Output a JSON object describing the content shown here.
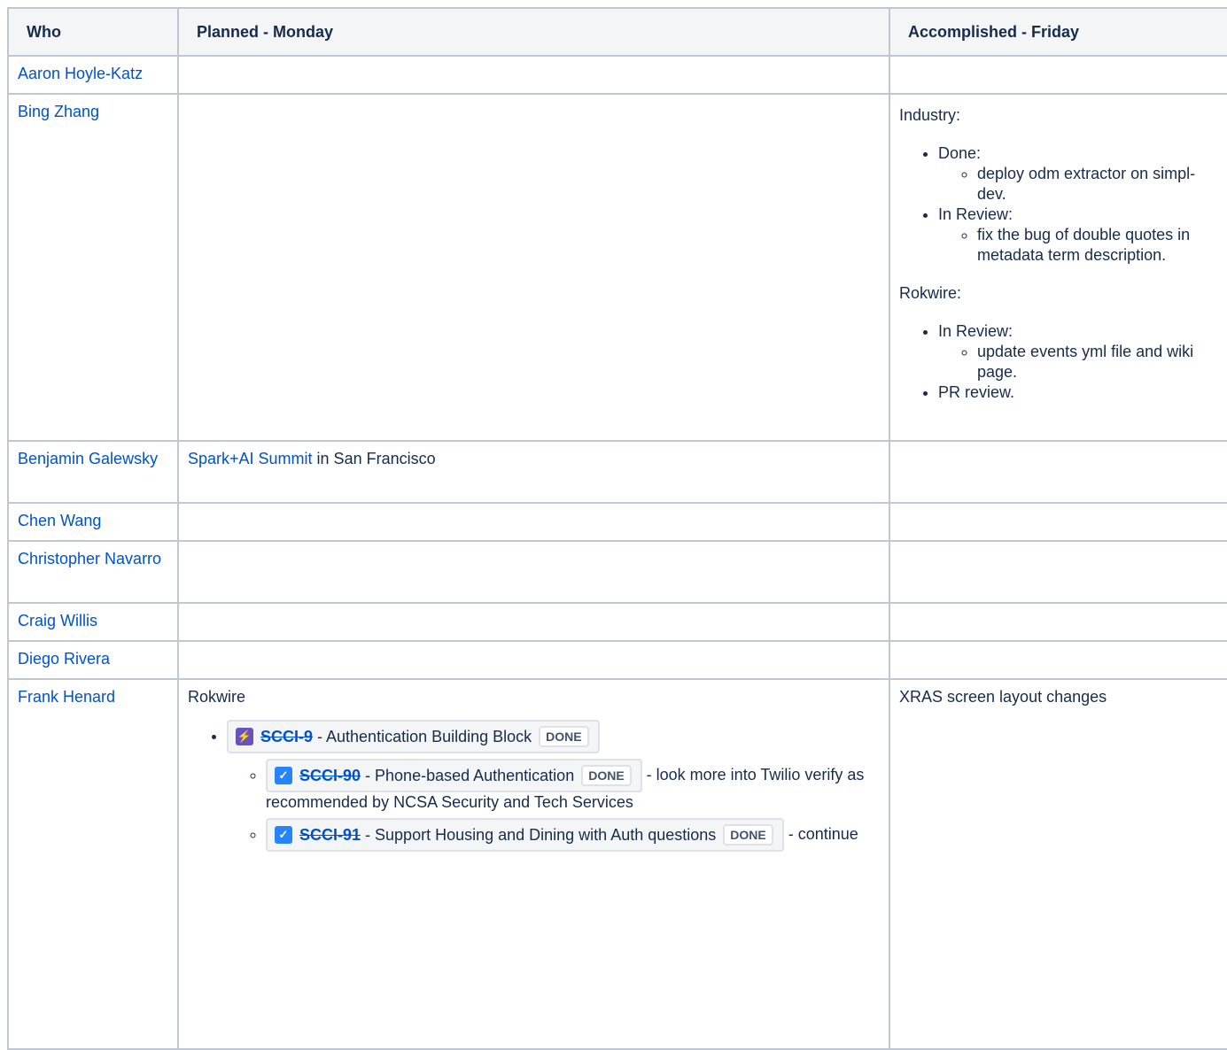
{
  "table": {
    "headers": {
      "who": "Who",
      "planned": "Planned - Monday",
      "accomplished": "Accomplished - Friday"
    }
  },
  "rows": {
    "aaron": {
      "name": "Aaron Hoyle-Katz"
    },
    "bing": {
      "name": "Bing Zhang",
      "accomplished": {
        "industry_title": "Industry:",
        "done_label": "Done:",
        "done_item": "deploy odm extractor on simpl-dev.",
        "inreview_label": "In Review:",
        "inreview_item": "fix the bug of double quotes in metadata term description.",
        "rokwire_title": "Rokwire:",
        "rokwire_inreview_label": "In Review:",
        "rokwire_inreview_item": "update events yml file and wiki page.",
        "pr_review": "PR review."
      }
    },
    "benjamin": {
      "name": "Benjamin Galewsky",
      "planned_link": "Spark+AI Summit",
      "planned_rest": " in San Francisco"
    },
    "chen": {
      "name": "Chen Wang"
    },
    "christopher": {
      "name": "Christopher Navarro"
    },
    "craig": {
      "name": "Craig Willis"
    },
    "diego": {
      "name": "Diego Rivera"
    },
    "frank": {
      "name": "Frank Henard",
      "planned_title": "Rokwire",
      "epic": {
        "icon": "epic-lightning-icon",
        "key": "SCCI-9",
        "summary": " - Authentication Building Block",
        "status": "DONE"
      },
      "subtasks": [
        {
          "icon": "task-checkbox-icon",
          "key": "SCCI-90",
          "summary": " - Phone-based Authentication",
          "status": "DONE",
          "note": " - look more into Twilio verify as recommended by NCSA Security and Tech Services"
        },
        {
          "icon": "task-checkbox-icon",
          "key": "SCCI-91",
          "summary": " - Support Housing and Dining with Auth questions",
          "status": "DONE",
          "note": " - continue"
        }
      ],
      "accomplished": "XRAS screen layout changes"
    }
  },
  "colors": {
    "link": "#0052cc",
    "border": "#c1c7d0",
    "header_bg": "#f4f5f7",
    "epic": "#6554c0",
    "task": "#2684ff"
  }
}
